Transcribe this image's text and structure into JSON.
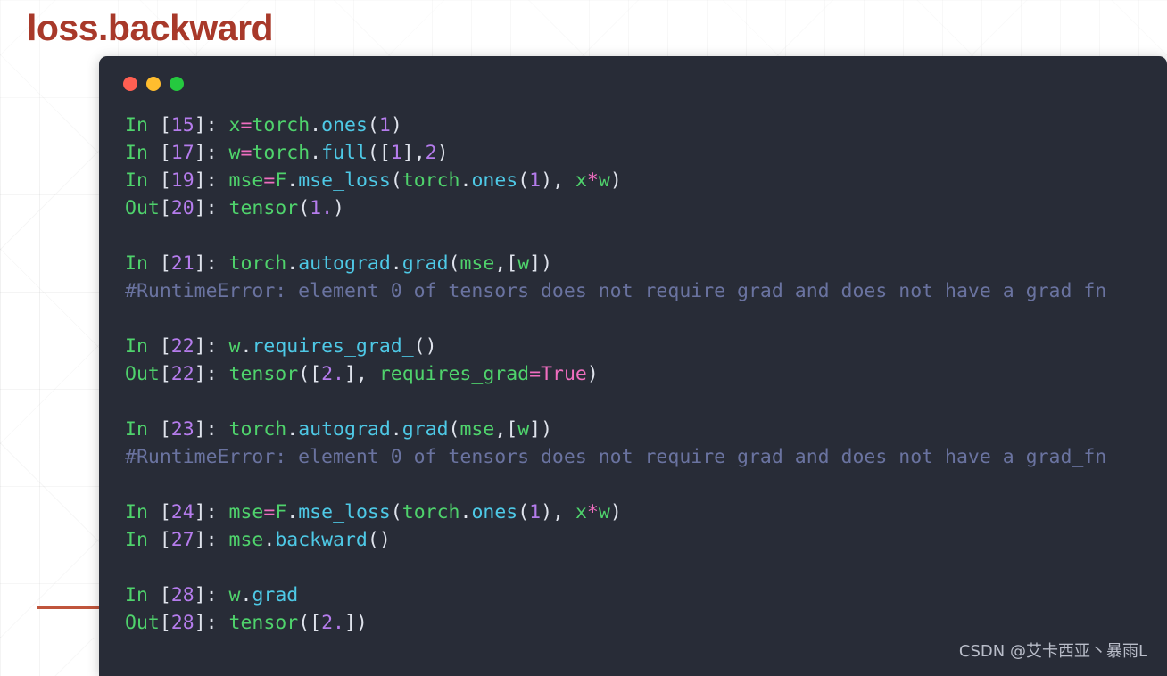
{
  "slide": {
    "title": "loss.backward",
    "title_color": "#a8392a",
    "accent_rule_color": "#c0553c",
    "background_color": "#ffffff"
  },
  "console": {
    "background_color": "#282c37",
    "titlebar": {
      "buttons": [
        {
          "name": "close",
          "icon": "circle-red-icon",
          "color": "#ff5f52"
        },
        {
          "name": "minimize",
          "icon": "circle-amber-icon",
          "color": "#ffbd2e"
        },
        {
          "name": "maximize",
          "icon": "circle-green-icon",
          "color": "#25c93f"
        }
      ]
    },
    "lines": [
      {
        "id": "in-15",
        "type": "input",
        "prompt": "In ",
        "number": "15",
        "text": "x=torch.ones(1)",
        "tokens": [
          {
            "t": "x",
            "c": "name"
          },
          {
            "t": "=",
            "c": "op"
          },
          {
            "t": "torch",
            "c": "name"
          },
          {
            "t": ".",
            "c": "punc"
          },
          {
            "t": "ones",
            "c": "attr"
          },
          {
            "t": "(",
            "c": "punc"
          },
          {
            "t": "1",
            "c": "num"
          },
          {
            "t": ")",
            "c": "punc"
          }
        ]
      },
      {
        "id": "in-17",
        "type": "input",
        "prompt": "In ",
        "number": "17",
        "text": "w=torch.full([1],2)",
        "tokens": [
          {
            "t": "w",
            "c": "name"
          },
          {
            "t": "=",
            "c": "op"
          },
          {
            "t": "torch",
            "c": "name"
          },
          {
            "t": ".",
            "c": "punc"
          },
          {
            "t": "full",
            "c": "attr"
          },
          {
            "t": "([",
            "c": "punc"
          },
          {
            "t": "1",
            "c": "num"
          },
          {
            "t": "],",
            "c": "punc"
          },
          {
            "t": "2",
            "c": "num"
          },
          {
            "t": ")",
            "c": "punc"
          }
        ]
      },
      {
        "id": "in-19",
        "type": "input",
        "prompt": "In ",
        "number": "19",
        "text": "mse=F.mse_loss(torch.ones(1), x*w)",
        "tokens": [
          {
            "t": "mse",
            "c": "name"
          },
          {
            "t": "=",
            "c": "op"
          },
          {
            "t": "F",
            "c": "name"
          },
          {
            "t": ".",
            "c": "punc"
          },
          {
            "t": "mse_loss",
            "c": "attr"
          },
          {
            "t": "(",
            "c": "punc"
          },
          {
            "t": "torch",
            "c": "name"
          },
          {
            "t": ".",
            "c": "punc"
          },
          {
            "t": "ones",
            "c": "attr"
          },
          {
            "t": "(",
            "c": "punc"
          },
          {
            "t": "1",
            "c": "num"
          },
          {
            "t": "), ",
            "c": "punc"
          },
          {
            "t": "x",
            "c": "name"
          },
          {
            "t": "*",
            "c": "op"
          },
          {
            "t": "w",
            "c": "name"
          },
          {
            "t": ")",
            "c": "punc"
          }
        ]
      },
      {
        "id": "out-20",
        "type": "output",
        "prompt": "Out",
        "number": "20",
        "text": "tensor(1.)",
        "tokens": [
          {
            "t": "tensor",
            "c": "name"
          },
          {
            "t": "(",
            "c": "punc"
          },
          {
            "t": "1.",
            "c": "num"
          },
          {
            "t": ")",
            "c": "punc"
          }
        ]
      },
      {
        "id": "blank-1",
        "type": "blank"
      },
      {
        "id": "in-21",
        "type": "input",
        "prompt": "In ",
        "number": "21",
        "text": "torch.autograd.grad(mse,[w])",
        "tokens": [
          {
            "t": "torch",
            "c": "name"
          },
          {
            "t": ".",
            "c": "punc"
          },
          {
            "t": "autograd",
            "c": "attr"
          },
          {
            "t": ".",
            "c": "punc"
          },
          {
            "t": "grad",
            "c": "attr"
          },
          {
            "t": "(",
            "c": "punc"
          },
          {
            "t": "mse",
            "c": "name"
          },
          {
            "t": ",[",
            "c": "punc"
          },
          {
            "t": "w",
            "c": "name"
          },
          {
            "t": "])",
            "c": "punc"
          }
        ]
      },
      {
        "id": "comment-21",
        "type": "comment",
        "text": "#RuntimeError: element 0 of tensors does not require grad and does not have a grad_fn"
      },
      {
        "id": "blank-2",
        "type": "blank"
      },
      {
        "id": "in-22",
        "type": "input",
        "prompt": "In ",
        "number": "22",
        "text": "w.requires_grad_()",
        "tokens": [
          {
            "t": "w",
            "c": "name"
          },
          {
            "t": ".",
            "c": "punc"
          },
          {
            "t": "requires_grad_",
            "c": "attr"
          },
          {
            "t": "()",
            "c": "punc"
          }
        ]
      },
      {
        "id": "out-22",
        "type": "output",
        "prompt": "Out",
        "number": "22",
        "text": "tensor([2.], requires_grad=True)",
        "tokens": [
          {
            "t": "tensor",
            "c": "name"
          },
          {
            "t": "([",
            "c": "punc"
          },
          {
            "t": "2.",
            "c": "num"
          },
          {
            "t": "], ",
            "c": "punc"
          },
          {
            "t": "requires_grad",
            "c": "name"
          },
          {
            "t": "=",
            "c": "op"
          },
          {
            "t": "True",
            "c": "kw"
          },
          {
            "t": ")",
            "c": "punc"
          }
        ]
      },
      {
        "id": "blank-3",
        "type": "blank"
      },
      {
        "id": "in-23",
        "type": "input",
        "prompt": "In ",
        "number": "23",
        "text": "torch.autograd.grad(mse,[w])",
        "tokens": [
          {
            "t": "torch",
            "c": "name"
          },
          {
            "t": ".",
            "c": "punc"
          },
          {
            "t": "autograd",
            "c": "attr"
          },
          {
            "t": ".",
            "c": "punc"
          },
          {
            "t": "grad",
            "c": "attr"
          },
          {
            "t": "(",
            "c": "punc"
          },
          {
            "t": "mse",
            "c": "name"
          },
          {
            "t": ",[",
            "c": "punc"
          },
          {
            "t": "w",
            "c": "name"
          },
          {
            "t": "])",
            "c": "punc"
          }
        ]
      },
      {
        "id": "comment-23",
        "type": "comment",
        "text": "#RuntimeError: element 0 of tensors does not require grad and does not have a grad_fn"
      },
      {
        "id": "blank-4",
        "type": "blank"
      },
      {
        "id": "in-24",
        "type": "input",
        "prompt": "In ",
        "number": "24",
        "text": "mse=F.mse_loss(torch.ones(1), x*w)",
        "tokens": [
          {
            "t": "mse",
            "c": "name"
          },
          {
            "t": "=",
            "c": "op"
          },
          {
            "t": "F",
            "c": "name"
          },
          {
            "t": ".",
            "c": "punc"
          },
          {
            "t": "mse_loss",
            "c": "attr"
          },
          {
            "t": "(",
            "c": "punc"
          },
          {
            "t": "torch",
            "c": "name"
          },
          {
            "t": ".",
            "c": "punc"
          },
          {
            "t": "ones",
            "c": "attr"
          },
          {
            "t": "(",
            "c": "punc"
          },
          {
            "t": "1",
            "c": "num"
          },
          {
            "t": "), ",
            "c": "punc"
          },
          {
            "t": "x",
            "c": "name"
          },
          {
            "t": "*",
            "c": "op"
          },
          {
            "t": "w",
            "c": "name"
          },
          {
            "t": ")",
            "c": "punc"
          }
        ]
      },
      {
        "id": "in-27",
        "type": "input",
        "prompt": "In ",
        "number": "27",
        "text": "mse.backward()",
        "tokens": [
          {
            "t": "mse",
            "c": "name"
          },
          {
            "t": ".",
            "c": "punc"
          },
          {
            "t": "backward",
            "c": "attr"
          },
          {
            "t": "()",
            "c": "punc"
          }
        ]
      },
      {
        "id": "blank-5",
        "type": "blank"
      },
      {
        "id": "in-28",
        "type": "input",
        "prompt": "In ",
        "number": "28",
        "text": "w.grad",
        "tokens": [
          {
            "t": "w",
            "c": "name"
          },
          {
            "t": ".",
            "c": "punc"
          },
          {
            "t": "grad",
            "c": "attr"
          }
        ]
      },
      {
        "id": "out-28",
        "type": "output",
        "prompt": "Out",
        "number": "28",
        "text": "tensor([2.])",
        "tokens": [
          {
            "t": "tensor",
            "c": "name"
          },
          {
            "t": "([",
            "c": "punc"
          },
          {
            "t": "2.",
            "c": "num"
          },
          {
            "t": "])",
            "c": "punc"
          }
        ]
      }
    ]
  },
  "watermark": {
    "text": "CSDN @艾卡西亚丶暴雨L"
  }
}
